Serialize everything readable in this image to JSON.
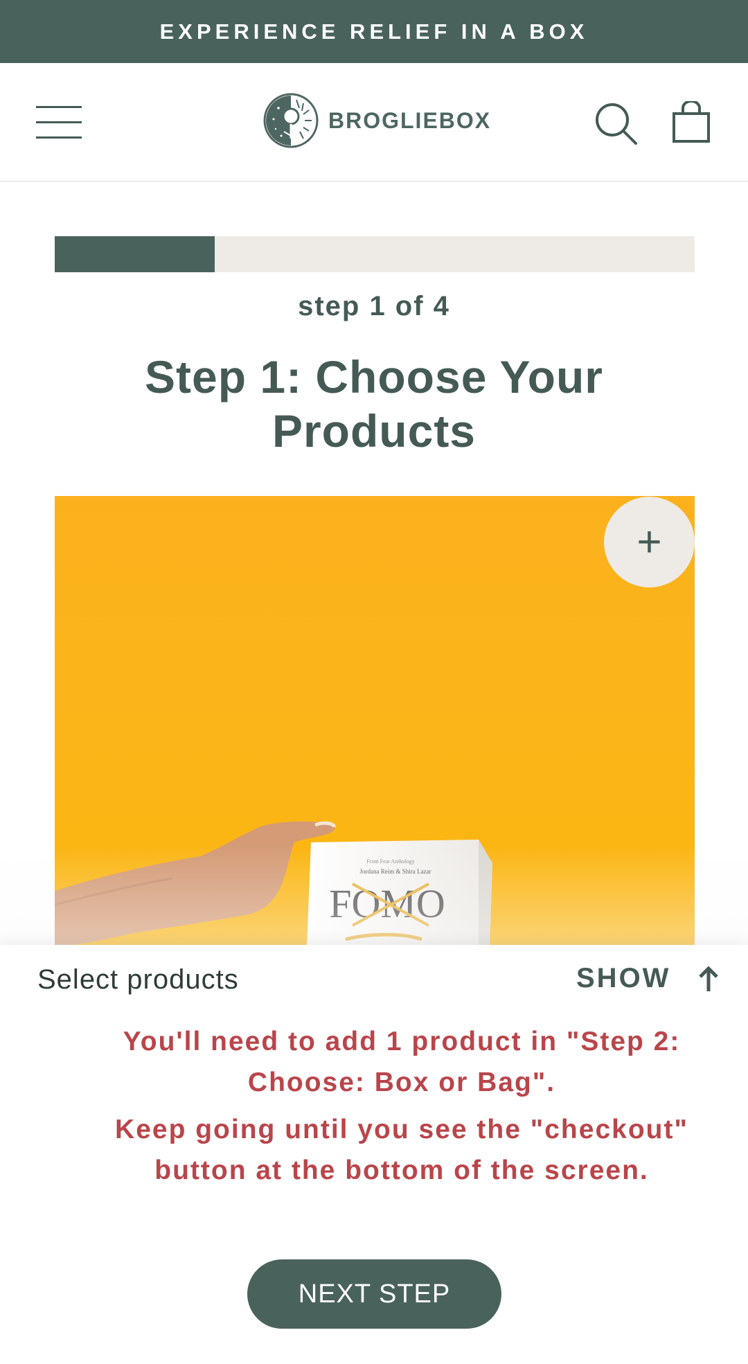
{
  "announcement": {
    "text": "EXPERIENCE RELIEF IN A BOX"
  },
  "header": {
    "brand": "BROGLIEBOX",
    "menu_icon": "hamburger-menu-icon",
    "search_icon": "search-icon",
    "cart_icon": "shopping-bag-icon"
  },
  "progress": {
    "value": 0.25
  },
  "step": {
    "counter": "step 1 of 4",
    "title": "Step 1: Choose Your Products"
  },
  "product": {
    "add_label": "+",
    "book_authors": "Jordana Reim & Shira Lazar",
    "book_title": "FOMO"
  },
  "panel": {
    "select_label": "Select products",
    "show_label": "SHOW",
    "warning_1": "You'll need to add 1 product in \"Step 2: Choose: Box or Bag\".",
    "warning_2": "Keep going until you see the \"checkout\" button at the bottom of the screen.",
    "next_label": "NEXT STEP"
  },
  "colors": {
    "primary": "#4a625c",
    "progress_track": "#eeeae6",
    "warning": "#b9454a",
    "product_bg": "#fbb31a"
  }
}
